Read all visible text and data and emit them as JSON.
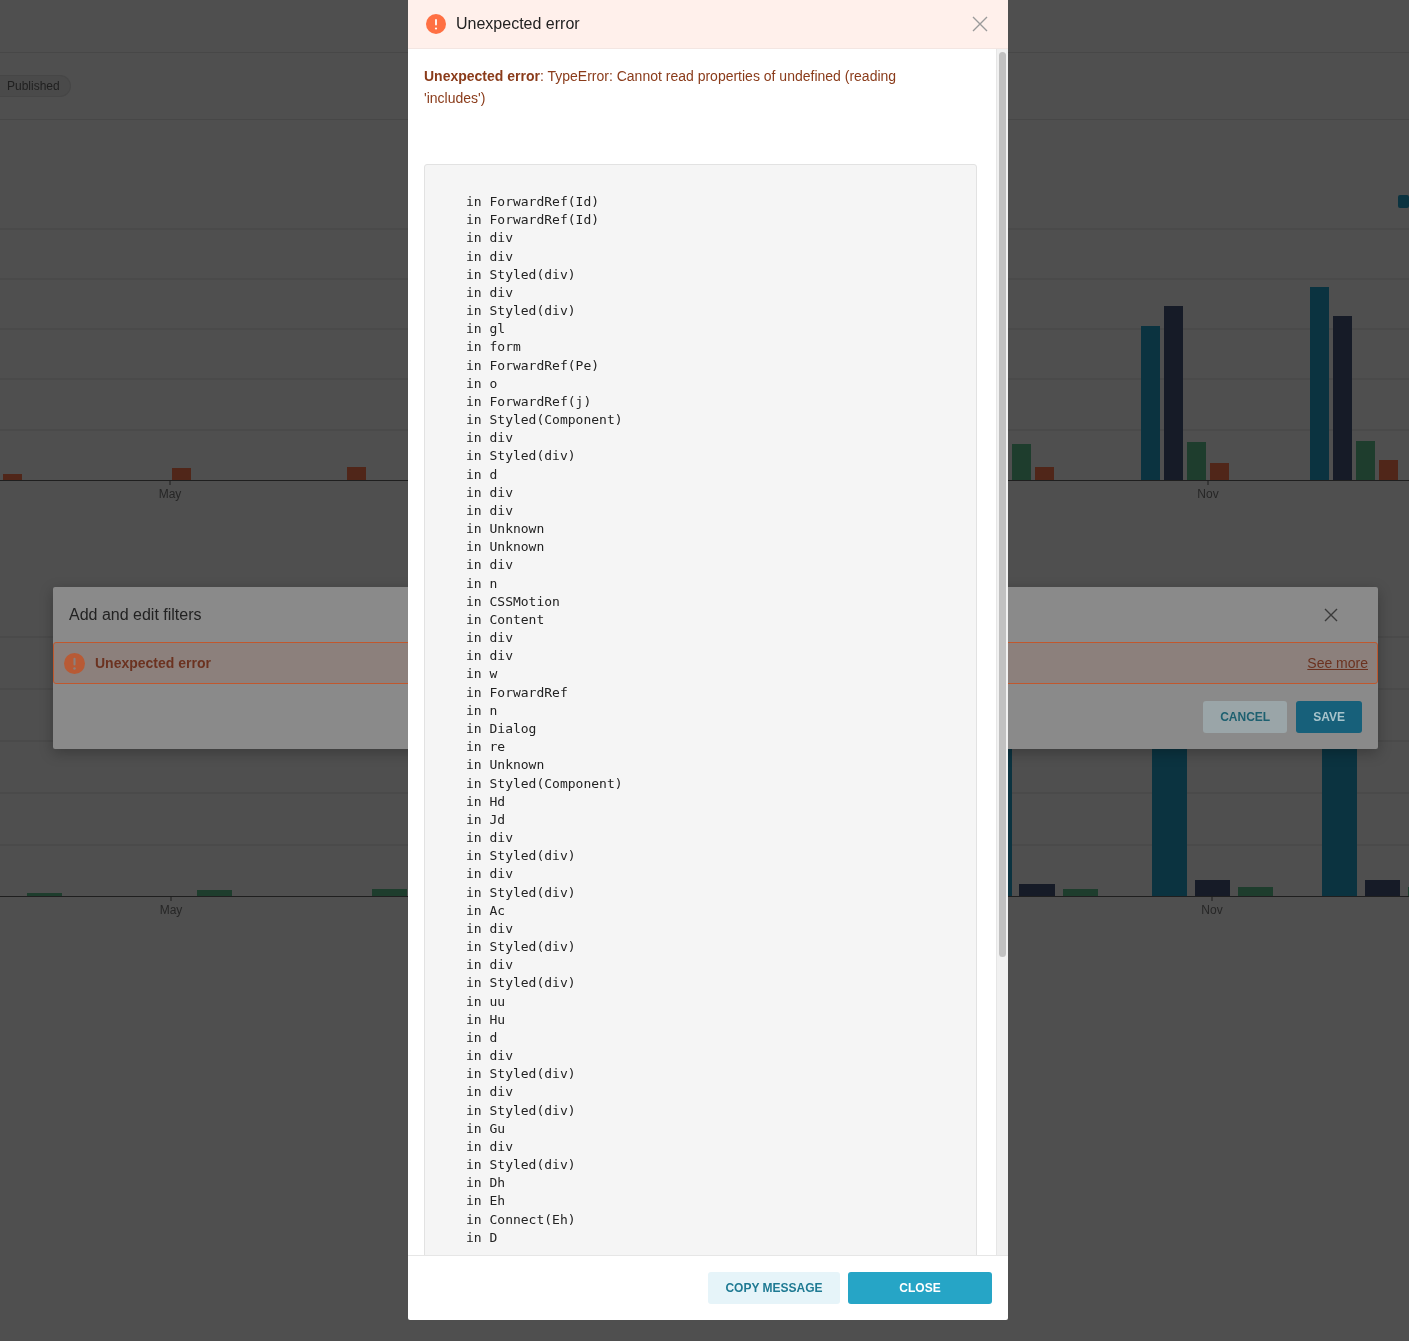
{
  "background_page": {
    "status_badge": "Published",
    "chart_top": {
      "x_labels": [
        "May",
        "Nov"
      ]
    },
    "chart_bottom": {
      "x_labels": [
        "May",
        "Nov"
      ]
    }
  },
  "filters_dialog": {
    "title": "Add and edit filters",
    "error_banner": {
      "message": "Unexpected error",
      "link": "See more"
    },
    "buttons": [
      {
        "label": "CANCEL",
        "kind": "secondary"
      },
      {
        "label": "SAVE",
        "kind": "primary"
      }
    ]
  },
  "error_dialog": {
    "title": "Unexpected error",
    "message": "**Unexpected error**: TypeError: Cannot read properties of undefined (reading 'includes')",
    "stack_trace": [
      "in ForwardRef(Id)",
      "in ForwardRef(Id)",
      "in div",
      "in div",
      "in Styled(div)",
      "in div",
      "in Styled(div)",
      "in gl",
      "in form",
      "in ForwardRef(Pe)",
      "in o",
      "in ForwardRef(j)",
      "in Styled(Component)",
      "in div",
      "in Styled(div)",
      "in d",
      "in div",
      "in div",
      "in Unknown",
      "in Unknown",
      "in div",
      "in n",
      "in CSSMotion",
      "in Content",
      "in div",
      "in div",
      "in w",
      "in ForwardRef",
      "in n",
      "in Dialog",
      "in re",
      "in Unknown",
      "in Styled(Component)",
      "in Hd",
      "in Jd",
      "in div",
      "in Styled(div)",
      "in div",
      "in Styled(div)",
      "in Ac",
      "in div",
      "in Styled(div)",
      "in div",
      "in Styled(div)",
      "in uu",
      "in Hu",
      "in d",
      "in div",
      "in Styled(div)",
      "in div",
      "in Styled(div)",
      "in Gu",
      "in div",
      "in Styled(div)",
      "in Dh",
      "in Eh",
      "in Connect(Eh)",
      "in D"
    ],
    "buttons": [
      {
        "label": "COPY MESSAGE",
        "kind": "secondary"
      },
      {
        "label": "CLOSE",
        "kind": "primary"
      }
    ]
  }
}
